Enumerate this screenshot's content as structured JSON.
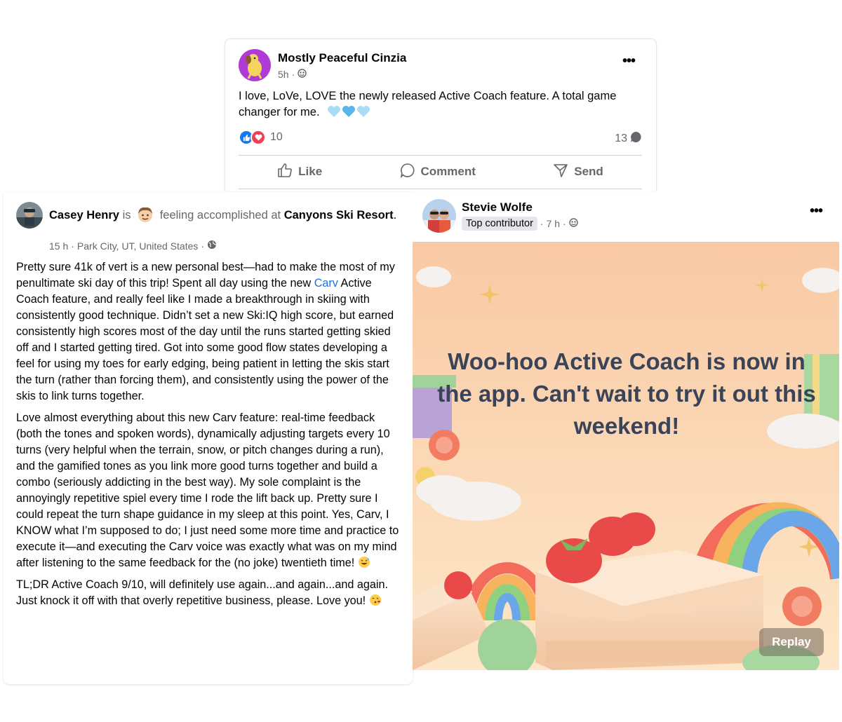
{
  "post1": {
    "author": "Mostly Peaceful Cinzia",
    "time": "5h",
    "dot": "·",
    "text": "I love, LoVe, LOVE the newly released Active Coach feature. A total game changer for me.",
    "reaction_count": "10",
    "comment_count": "13",
    "actions": {
      "like": "Like",
      "comment": "Comment",
      "send": "Send"
    },
    "colors": {
      "like_blue": "#1877f2",
      "love_red": "#f33e58",
      "heart_blue": "#7cc6f2"
    }
  },
  "post2": {
    "author": "Casey Henry",
    "is_word": "is",
    "feeling": "feeling accomplished at",
    "place": "Canyons Ski Resort",
    "period": ".",
    "time": "15 h",
    "location": "Park City, UT, United States",
    "dot": "·",
    "p1_a": "Pretty sure 41k of vert is a new personal best—had to make the most of my penultimate ski day of this trip! Spent all day using the new",
    "p1_link": "Carv",
    "p1_b": "Active Coach feature, and really feel like I made a breakthrough in skiing with consistently good technique. Didn’t set a new Ski:IQ high score, but earned consistently high scores most of the day until the runs started getting skied off and I started getting tired. Got into some good flow states developing a feel for using my toes for early edging, being patient in letting the skis start the turn (rather than forcing them), and consistently using the power of the skis to link turns together.",
    "p2": "Love almost everything about this new Carv feature: real-time feedback (both the tones and spoken words), dynamically adjusting targets every 10 turns (very helpful when the terrain, snow, or pitch changes during a run), and the gamified tones as you link more good turns together and build a combo (seriously addicting in the best way). My sole complaint is the annoyingly repetitive spiel every time I rode the lift back up. Pretty sure I could repeat the turn shape guidance in my sleep at this point. Yes, Carv, I KNOW what I’m supposed to do; I just need some more time and practice to execute it—and executing the Carv voice was exactly what was on my mind after listening to the same feedback for the (no joke) twentieth time!",
    "p3": "TL;DR Active Coach 9/10, will definitely use again...and again...and again. Just knock it off with that overly repetitive business, please. Love you!"
  },
  "post3": {
    "author": "Stevie Wolfe",
    "badge": "Top contributor",
    "dot": "·",
    "time": "7 h",
    "headline": "Woo-hoo Active Coach is now in the app. Can't wait to try it out this weekend!",
    "replay": "Replay",
    "colors": {
      "headline": "#3b4357",
      "bg_top": "#f9c9a4",
      "bg_bottom": "#fde3c2"
    }
  }
}
